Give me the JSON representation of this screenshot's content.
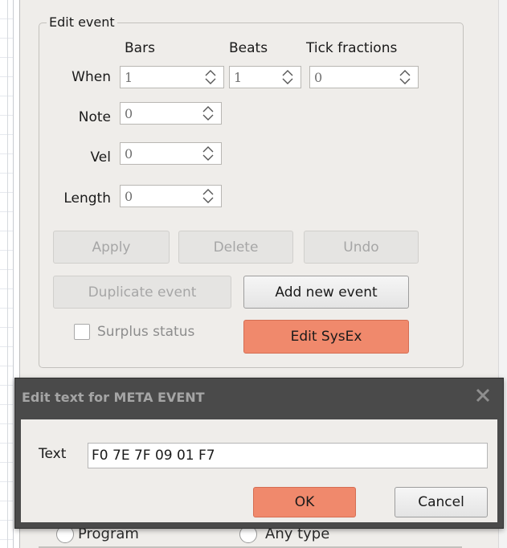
{
  "group": {
    "title": "Edit event"
  },
  "columns": {
    "bars": "Bars",
    "beats": "Beats",
    "tick": "Tick fractions"
  },
  "fields": {
    "when_label": "When",
    "when_bars": "1",
    "when_beats": "1",
    "when_ticks": "0",
    "note_label": "Note",
    "note_value": "0",
    "vel_label": "Vel",
    "vel_value": "0",
    "length_label": "Length",
    "length_value": "0"
  },
  "buttons": {
    "apply": "Apply",
    "delete": "Delete",
    "undo": "Undo",
    "duplicate": "Duplicate event",
    "add_new": "Add new event",
    "edit_sysex": "Edit SysEx"
  },
  "checkbox": {
    "surplus": "Surplus status",
    "checked": false
  },
  "behind": {
    "program": "Program",
    "any_type": "Any type"
  },
  "dialog": {
    "title": "Edit text for META EVENT",
    "text_label": "Text",
    "text_value": "F0 7E 7F 09 01 F7",
    "ok": "OK",
    "cancel": "Cancel"
  },
  "colors": {
    "accent": "#f0896c",
    "panel": "#efedea",
    "dialog_frame": "#4a4a4a"
  }
}
